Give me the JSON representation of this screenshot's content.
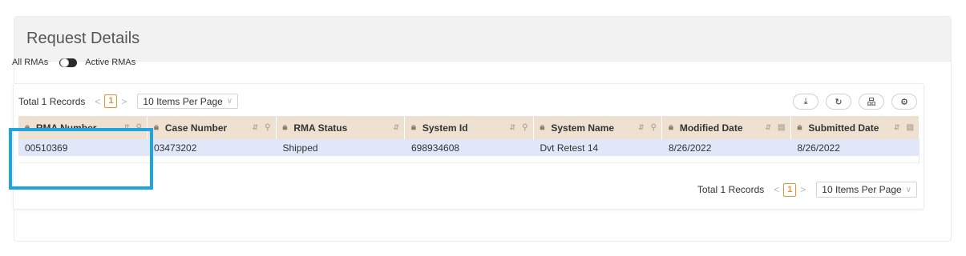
{
  "panel": {
    "title": "Request Details"
  },
  "toggle": {
    "left_label": "All RMAs",
    "right_label": "Active RMAs"
  },
  "pagination_top": {
    "total": "Total 1 Records",
    "prev": "<",
    "page": "1",
    "next": ">",
    "per_page": "10 Items Per Page",
    "chevron": "∨"
  },
  "actions": [
    {
      "name": "download-icon",
      "glyph": "⤓"
    },
    {
      "name": "refresh-icon",
      "glyph": "↻"
    },
    {
      "name": "hierarchy-icon",
      "glyph": "品"
    },
    {
      "name": "settings-icon",
      "glyph": "⚙"
    }
  ],
  "table": {
    "columns": [
      {
        "label": "RMA Number",
        "tool": "search"
      },
      {
        "label": "Case Number",
        "tool": "search"
      },
      {
        "label": "RMA Status",
        "tool": "none"
      },
      {
        "label": "System Id",
        "tool": "search"
      },
      {
        "label": "System Name",
        "tool": "search"
      },
      {
        "label": "Modified Date",
        "tool": "calendar"
      },
      {
        "label": "Submitted Date",
        "tool": "calendar"
      }
    ],
    "rows": [
      [
        "00510369",
        "03473202",
        "Shipped",
        "698934608",
        "Dvt Retest 14",
        "8/26/2022",
        "8/26/2022"
      ]
    ]
  },
  "pagination_bottom": {
    "total": "Total 1 Records",
    "prev": "<",
    "page": "1",
    "next": ">",
    "per_page": "10 Items Per Page",
    "chevron": "∨"
  },
  "colors": {
    "accent": "#e8913c",
    "link": "#e2664a",
    "header_bg": "#efe1d2",
    "row_bg": "#dfe7f8",
    "highlight": "#1ea4e0"
  }
}
